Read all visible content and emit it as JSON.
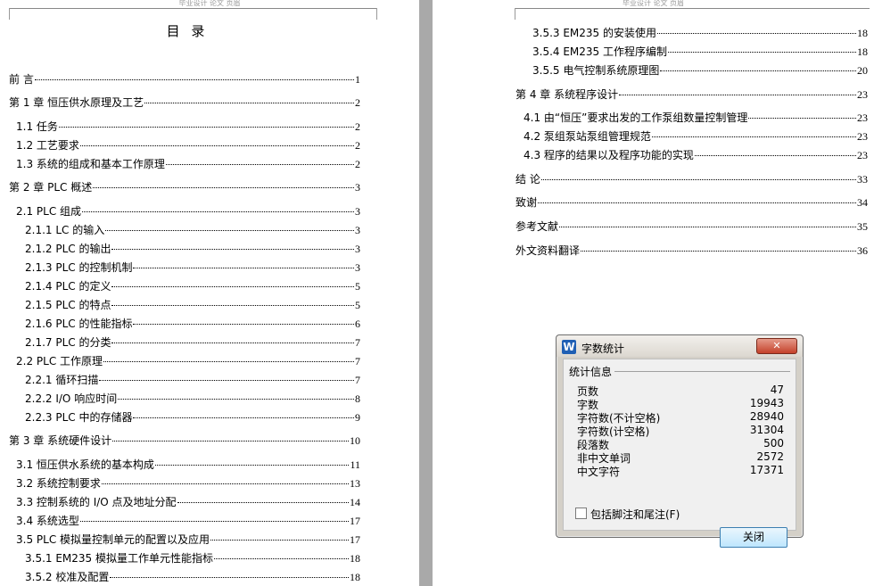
{
  "header_text": "毕业设计 论文 页眉",
  "toc_title": "目 录",
  "left_page": [
    {
      "label": "前  言",
      "page": "1"
    },
    {
      "label": "第 1 章  恒压供水原理及工艺",
      "page": "2"
    },
    {
      "label": "1.1  任务",
      "page": "2"
    },
    {
      "label": "1.2  工艺要求",
      "page": "2"
    },
    {
      "label": "1.3  系统的组成和基本工作原理",
      "page": "2"
    },
    {
      "label": "第 2 章    PLC 概述",
      "page": "3"
    },
    {
      "label": "2.1 PLC 组成",
      "page": "3"
    },
    {
      "label": "2.1.1 LC 的输入",
      "page": "3"
    },
    {
      "label": "2.1.2 PLC 的输出",
      "page": "3"
    },
    {
      "label": "2.1.3 PLC 的控制机制",
      "page": "3"
    },
    {
      "label": "2.1.4 PLC 的定义",
      "page": "5"
    },
    {
      "label": "2.1.5 PLC 的特点",
      "page": "5"
    },
    {
      "label": "2.1.6 PLC 的性能指标",
      "page": "6"
    },
    {
      "label": "2.1.7 PLC 的分类",
      "page": "7"
    },
    {
      "label": "2.2      PLC 工作原理",
      "page": "7"
    },
    {
      "label": "2.2.1  循环扫描",
      "page": "7"
    },
    {
      "label": "2.2.2 I/O 响应时间",
      "page": "8"
    },
    {
      "label": "2.2.3 PLC 中的存储器",
      "page": "9"
    },
    {
      "label": "第 3 章  系统硬件设计",
      "page": "10"
    },
    {
      "label": "3.1  恒压供水系统的基本构成",
      "page": "11"
    },
    {
      "label": "3.2  系统控制要求",
      "page": "13"
    },
    {
      "label": "3.3  控制系统的 I/O 点及地址分配",
      "page": "14"
    },
    {
      "label": "3.4  系统选型",
      "page": "17"
    },
    {
      "label": "3.5    PLC 模拟量控制单元的配置以及应用",
      "page": "17"
    },
    {
      "label": "3.5.1 EM235 模拟量工作单元性能指标",
      "page": "18"
    },
    {
      "label": "3.5.2  校准及配置",
      "page": "18"
    }
  ],
  "right_page": [
    {
      "label": "3.5.3 EM235 的安装使用",
      "page": "18"
    },
    {
      "label": "3.5.4 EM235 工作程序编制",
      "page": "18"
    },
    {
      "label": "3.5.5  电气控制系统原理图",
      "page": "20"
    },
    {
      "label": "第 4 章  系统程序设计",
      "page": "23"
    },
    {
      "label": "4.1  由“恒压”要求出发的工作泵组数量控制管理",
      "page": "23"
    },
    {
      "label": "4.2  泵组泵站泵组管理规范",
      "page": "23"
    },
    {
      "label": "4.3  程序的结果以及程序功能的实现",
      "page": "23"
    },
    {
      "label": "结  论",
      "page": "33"
    },
    {
      "label": "致谢",
      "page": "34"
    },
    {
      "label": "参考文献",
      "page": "35"
    },
    {
      "label": "外文资料翻译",
      "page": "36"
    }
  ],
  "dialog": {
    "app_icon": "W",
    "title": "字数统计",
    "close_icon": "✕",
    "group_label": "统计信息",
    "stats": [
      {
        "label": "页数",
        "value": "47"
      },
      {
        "label": "字数",
        "value": "19943"
      },
      {
        "label": "字符数(不计空格)",
        "value": "28940"
      },
      {
        "label": "字符数(计空格)",
        "value": "31304"
      },
      {
        "label": "段落数",
        "value": "500"
      },
      {
        "label": "非中文单词",
        "value": "2572"
      },
      {
        "label": "中文字符",
        "value": "17371"
      }
    ],
    "checkbox_label": "包括脚注和尾注(F)",
    "checkbox_checked": false,
    "close_button": "关闭"
  }
}
